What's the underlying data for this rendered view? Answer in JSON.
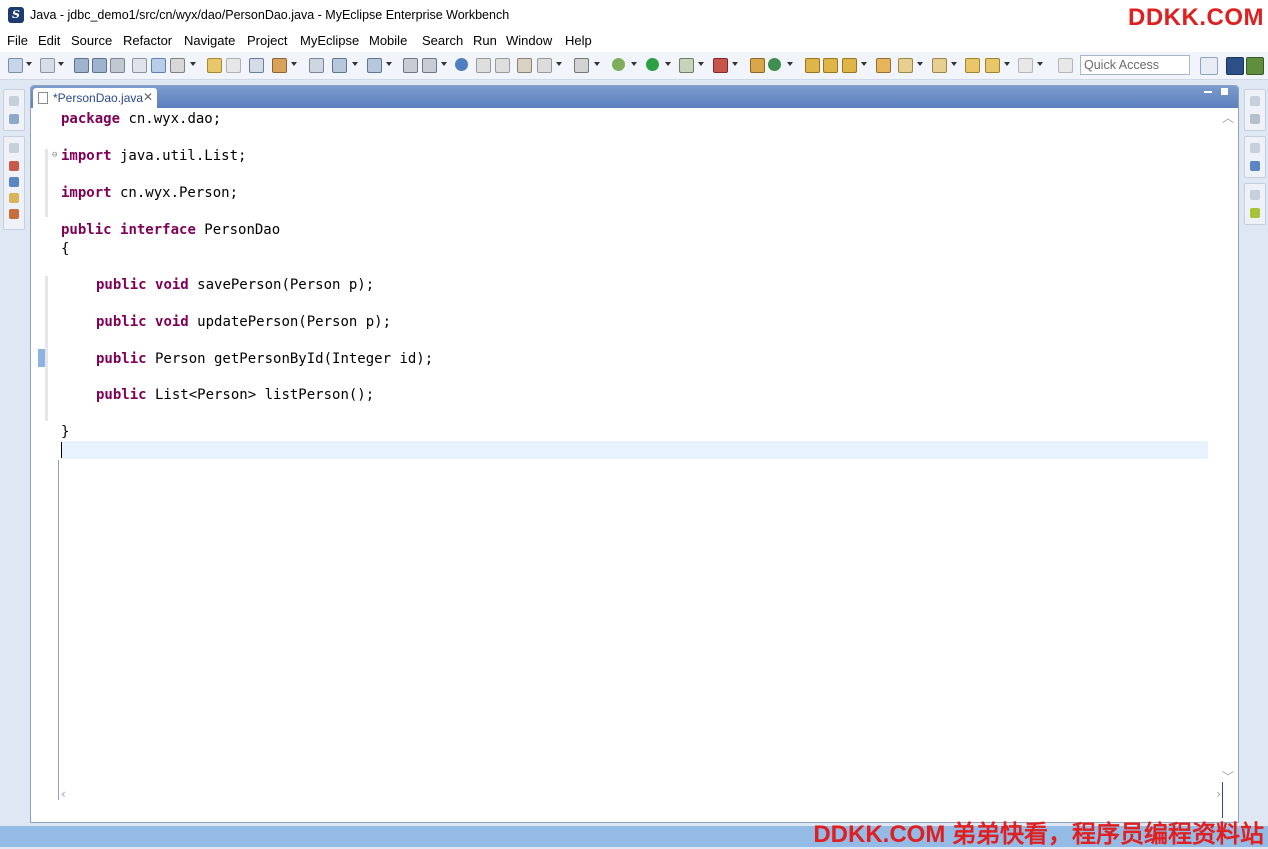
{
  "window": {
    "title": "Java - jdbc_demo1/src/cn/wyx/dao/PersonDao.java - MyEclipse Enterprise Workbench",
    "watermark_top": "DDKK.COM"
  },
  "menu": [
    "File",
    "Edit",
    "Source",
    "Refactor",
    "Navigate",
    "Project",
    "MyEclipse",
    "Mobile",
    "Search",
    "Run",
    "Window",
    "Help"
  ],
  "toolbar": {
    "quick_access": "Quick Access",
    "accent": "#5d80bd"
  },
  "editor": {
    "tab_label": "*PersonDao.java",
    "tab_close": "✕",
    "code": {
      "l1": {
        "kw": "package",
        "rest": " cn.wyx.dao;"
      },
      "l2": {
        "kw": "import",
        "rest": " java.util.List;"
      },
      "l3": {
        "kw": "import",
        "rest": " cn.wyx.Person;"
      },
      "l4": {
        "kw1": "public",
        "kw2": "interface",
        "rest": " PersonDao"
      },
      "l5": {
        "rest": "{"
      },
      "l6": {
        "kw1": "public",
        "kw2": "void",
        "rest": " savePerson(Person p);"
      },
      "l7": {
        "kw1": "public",
        "kw2": "void",
        "rest": " updatePerson(Person p);"
      },
      "l8": {
        "kw": "public",
        "rest": " Person getPersonById(Integer id);"
      },
      "l9": {
        "kw": "public",
        "rest": " List<Person> listPerson();"
      },
      "l10": {
        "rest": "}"
      }
    }
  },
  "status": {
    "watermark_bottom": "DDKK.COM 弟弟快看，程序员编程资料站"
  }
}
